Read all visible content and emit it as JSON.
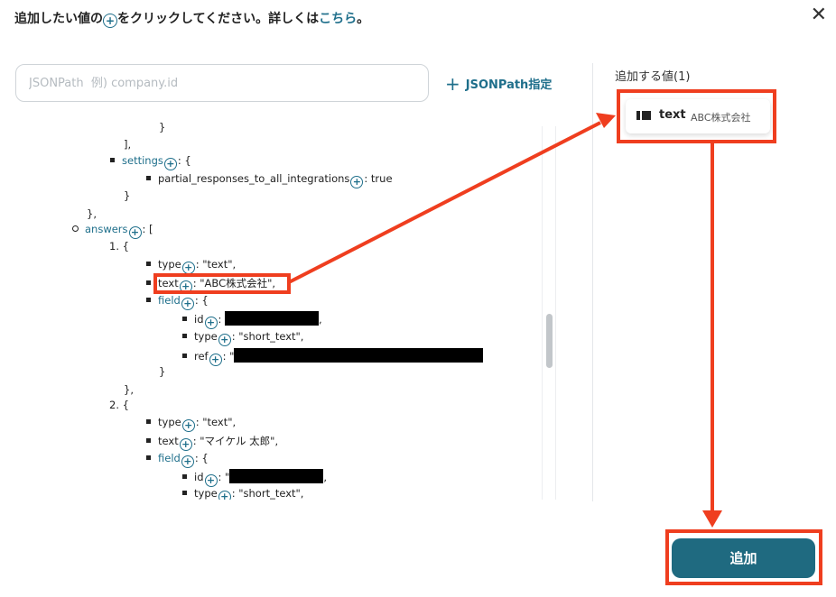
{
  "header": {
    "before": "追加したい値の",
    "plus": "+",
    "middle": "をクリックしてください。詳しくは",
    "link": "こちら",
    "end": "。"
  },
  "close_glyph": "✕",
  "search": {
    "placeholder": "JSONPath  例) company.id",
    "value": ""
  },
  "jsonpath_button": {
    "plus": "+",
    "label": "JSONPath指定"
  },
  "tree": {
    "plus": "+",
    "close_brace": "}",
    "close_bracket": "],",
    "close_brace_comma": "},",
    "settings_key": "settings",
    "colon_open_brace": ": {",
    "colon_open_bracket": ": [",
    "partial_key": "partial_responses_to_all_integrations",
    "partial_val": ": true",
    "answers_key": "answers",
    "item1_num": "1. {",
    "item2_num": "2. {",
    "type_key": "type",
    "text_key": "text",
    "field_key": "field",
    "id_key": "id",
    "ref_key": "ref",
    "colon": ":",
    "comma": ",",
    "quote": "\"",
    "colon_quote": ": \"",
    "val_text_type": ": \"text\",",
    "val_abc": ": \"ABC株式会社\",",
    "val_short_text": ": \"short_text\",",
    "val_name": ": \"マイケル 太郎\","
  },
  "added_panel": {
    "title": "追加する値(1)",
    "chip_label": "text",
    "chip_value": "ABC株式会社"
  },
  "add_button": "追加",
  "colors": {
    "accent": "#1f6f8b",
    "button": "#1f6a80",
    "highlight": "#ef3e1f"
  }
}
